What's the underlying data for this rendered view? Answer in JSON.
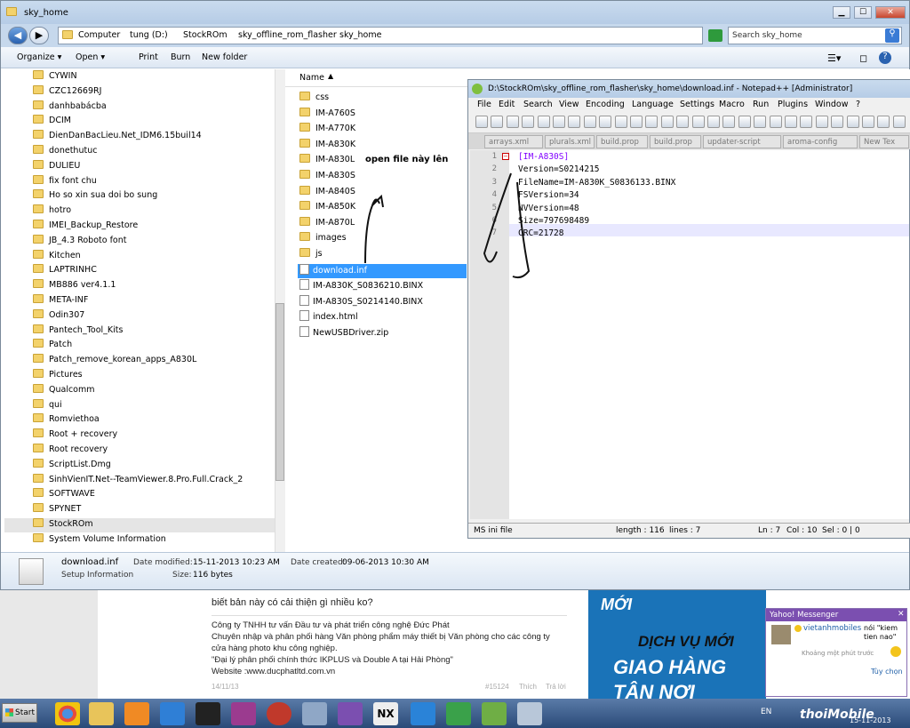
{
  "explorer": {
    "title": "sky_home",
    "breadcrumb": [
      "Computer",
      "tung (D:)",
      "StockROm",
      "sky_offline_rom_flasher",
      "sky_home"
    ],
    "search_placeholder": "Search sky_home",
    "toolbar": {
      "organize": "Organize ▾",
      "open": "Open ▾",
      "print": "Print",
      "burn": "Burn",
      "new_folder": "New folder"
    },
    "column_name": "Name",
    "tree": [
      "CYWIN",
      "CZC12669RJ",
      "danhbabácba",
      "DCIM",
      "DienDanBacLieu.Net_IDM6.15buil14",
      "donethutuc",
      "DULIEU",
      "fix font chu",
      "Ho so xin sua doi bo sung",
      "hotro",
      "IMEI_Backup_Restore",
      "JB_4.3 Roboto font",
      "Kitchen",
      "LAPTRINHC",
      "MB886 ver4.1.1",
      "META-INF",
      "Odin307",
      "Pantech_Tool_Kits",
      "Patch",
      "Patch_remove_korean_apps_A830L",
      "Pictures",
      "Qualcomm",
      "qui",
      "Romviethoa",
      "Root + recovery",
      "Root recovery",
      "ScriptList.Dmg",
      "SinhVienIT.Net--TeamViewer.8.Pro.Full.Crack_2",
      "SOFTWAVE",
      "SPYNET",
      "StockROm",
      "System Volume Information"
    ],
    "files": [
      "css",
      "IM-A760S",
      "IM-A770K",
      "IM-A830K",
      "IM-A830L",
      "IM-A830S",
      "IM-A840S",
      "IM-A850K",
      "IM-A870L",
      "images",
      "js",
      "download.inf",
      "IM-A830K_S0836210.BINX",
      "IM-A830S_S0214140.BINX",
      "index.html",
      "NewUSBDriver.zip"
    ],
    "annotation": "open file này lên",
    "details": {
      "filename": "download.inf",
      "type": "Setup Information",
      "date_modified_label": "Date modified:",
      "date_modified": "15-11-2013 10:23 AM",
      "size_label": "Size:",
      "size": "116 bytes",
      "date_created_label": "Date created:",
      "date_created": "09-06-2013 10:30 AM"
    }
  },
  "npp": {
    "title": "D:\\StockROm\\sky_offline_rom_flasher\\sky_home\\download.inf - Notepad++ [Administrator]",
    "menu": [
      "File",
      "Edit",
      "Search",
      "View",
      "Encoding",
      "Language",
      "Settings",
      "Macro",
      "Run",
      "Plugins",
      "Window",
      "?"
    ],
    "tabs": [
      "arrays.xml",
      "plurals.xml",
      "build.prop",
      "build.prop",
      "updater-script",
      "aroma-config",
      "New Tex"
    ],
    "lines": [
      "[IM-A830S]",
      "Version=S0214215",
      "FileName=IM-A830K_S0836133.BINX",
      "FSVersion=34",
      "NVVersion=48",
      "Size=797698489",
      "CRC=21728"
    ],
    "status": {
      "type": "MS ini file",
      "length": "length : 116",
      "lines": "lines : 7",
      "ln": "Ln : 7",
      "col": "Col : 10",
      "sel": "Sel : 0 | 0"
    }
  },
  "web": {
    "top_line": "biết bản này có cải thiện gì nhiều ko?",
    "lines": [
      "Công ty TNHH tư vấn Đầu tư và phát triển công nghệ Đức Phát",
      "Chuyên nhập và phân phối hàng Văn phòng phẩm máy thiết bị Văn phòng cho các công ty",
      "cửa hàng photo khu công nghiệp.",
      "\"Đại lý phân phối chính thức IKPLUS và Double A tại Hải Phòng\"",
      "Website :www.ducphatltd.com.vn"
    ],
    "footer": [
      "14/11/13",
      "#15124",
      "Thích",
      "Trả lời"
    ],
    "ad_lines": [
      "MỚI",
      "DỊCH VỤ MỚI",
      "GIAO HÀNG",
      "TẬN NƠI"
    ]
  },
  "yahoo": {
    "title": "Yahoo! Messenger",
    "user": "vietanhmobiles",
    "said": "nói \"kiem tien nao\"",
    "time": "Khoảng một phút trước",
    "reply": "Tùy chọn"
  },
  "taskbar": {
    "start": "Start",
    "lang": "EN",
    "date": "15-11-2013",
    "watermark": "thoiMobile"
  },
  "colors": {
    "accent": "#3399ff",
    "npp_keyword": "#8000ff",
    "npp_value": "#000000"
  }
}
